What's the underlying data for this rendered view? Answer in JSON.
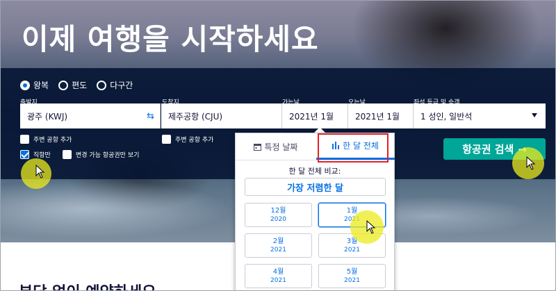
{
  "hero": {
    "title": "이제 여행을 시작하세요"
  },
  "trip_types": [
    {
      "label": "왕복",
      "checked": true
    },
    {
      "label": "편도",
      "checked": false
    },
    {
      "label": "다구간",
      "checked": false
    }
  ],
  "fields": {
    "from": {
      "label": "출발지",
      "value": "광주 (KWJ)"
    },
    "to": {
      "label": "도착지",
      "value": "제주공항 (CJU)"
    },
    "depart": {
      "label": "가는날",
      "value": "2021년 1월"
    },
    "return": {
      "label": "오는날",
      "value": "2021년 1월"
    },
    "cabin": {
      "label": "좌석 등급 및 승객",
      "value": "1 성인, 일반석"
    }
  },
  "checkboxes": {
    "nearby_from": {
      "label": "주변 공항 추가",
      "checked": false
    },
    "nearby_to": {
      "label": "주변 공항 추가",
      "checked": false
    },
    "direct": {
      "label": "직항만",
      "checked": true
    },
    "flexible": {
      "label": "변경 가능 항공권만 보기",
      "checked": false
    }
  },
  "search_button": {
    "label": "항공권 검색",
    "arrow": "→"
  },
  "date_popup": {
    "tabs": [
      {
        "label": "특정 날짜",
        "icon": "calendar-icon",
        "active": false
      },
      {
        "label": "한 달 전체",
        "icon": "bar-chart-icon",
        "active": true
      }
    ],
    "compare_label": "한 달 전체 비교:",
    "cheapest_label": "가장 저렴한 달",
    "months": [
      {
        "month": "12월",
        "year": "2020",
        "selected": false
      },
      {
        "month": "1월",
        "year": "2021",
        "selected": true
      },
      {
        "month": "2월",
        "year": "2021",
        "selected": false
      },
      {
        "month": "3월",
        "year": "2021",
        "selected": false
      },
      {
        "month": "4월",
        "year": "2021",
        "selected": false
      },
      {
        "month": "5월",
        "year": "2021",
        "selected": false
      }
    ]
  },
  "bottom_heading": "부담 없이 예약하세요",
  "colors": {
    "primary": "#0770e3",
    "search_button": "#00a698",
    "band": "#021230",
    "highlight": "#ebeb1e",
    "outline": "#e0202a"
  }
}
